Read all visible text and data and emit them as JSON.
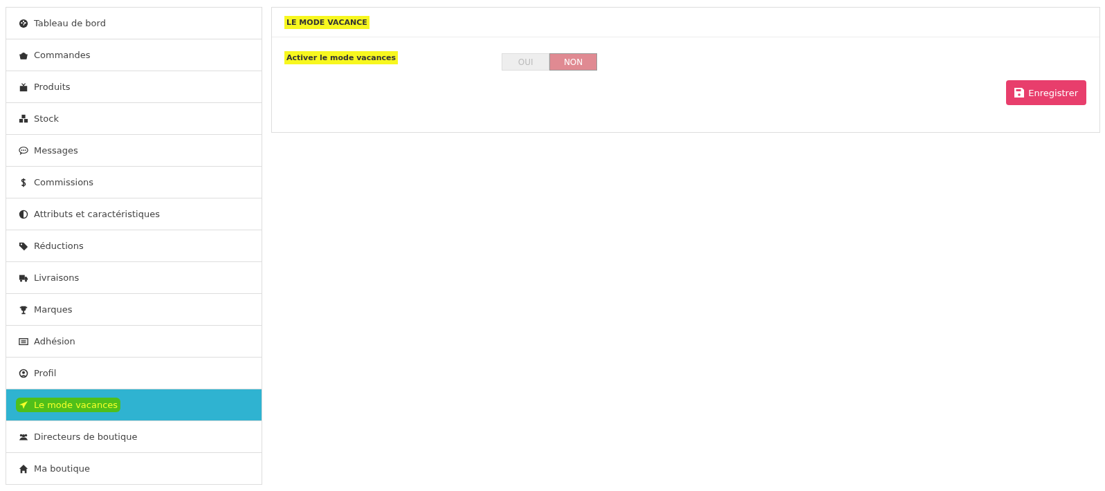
{
  "sidebar": {
    "items": [
      {
        "label": "Tableau de bord",
        "selected": false,
        "highlighted": false
      },
      {
        "label": "Commandes",
        "selected": false,
        "highlighted": false
      },
      {
        "label": "Produits",
        "selected": false,
        "highlighted": false
      },
      {
        "label": "Stock",
        "selected": false,
        "highlighted": false
      },
      {
        "label": "Messages",
        "selected": false,
        "highlighted": false
      },
      {
        "label": "Commissions",
        "selected": false,
        "highlighted": false
      },
      {
        "label": "Attributs et caractéristiques",
        "selected": false,
        "highlighted": false
      },
      {
        "label": "Réductions",
        "selected": false,
        "highlighted": false
      },
      {
        "label": "Livraisons",
        "selected": false,
        "highlighted": false
      },
      {
        "label": "Marques",
        "selected": false,
        "highlighted": false
      },
      {
        "label": "Adhésion",
        "selected": false,
        "highlighted": false
      },
      {
        "label": "Profil",
        "selected": false,
        "highlighted": false
      },
      {
        "label": "Le mode vacances",
        "selected": true,
        "highlighted": true
      },
      {
        "label": "Directeurs de boutique",
        "selected": false,
        "highlighted": false
      },
      {
        "label": "Ma boutique",
        "selected": false,
        "highlighted": false
      }
    ]
  },
  "panel": {
    "title": "LE MODE VACANCE",
    "title_highlighted": true,
    "field": {
      "label": "Activer le mode vacances",
      "label_highlighted": true,
      "options": [
        {
          "label": "OUI",
          "selected": false
        },
        {
          "label": "NON",
          "selected": true
        }
      ]
    },
    "save_button": "Enregistrer"
  }
}
